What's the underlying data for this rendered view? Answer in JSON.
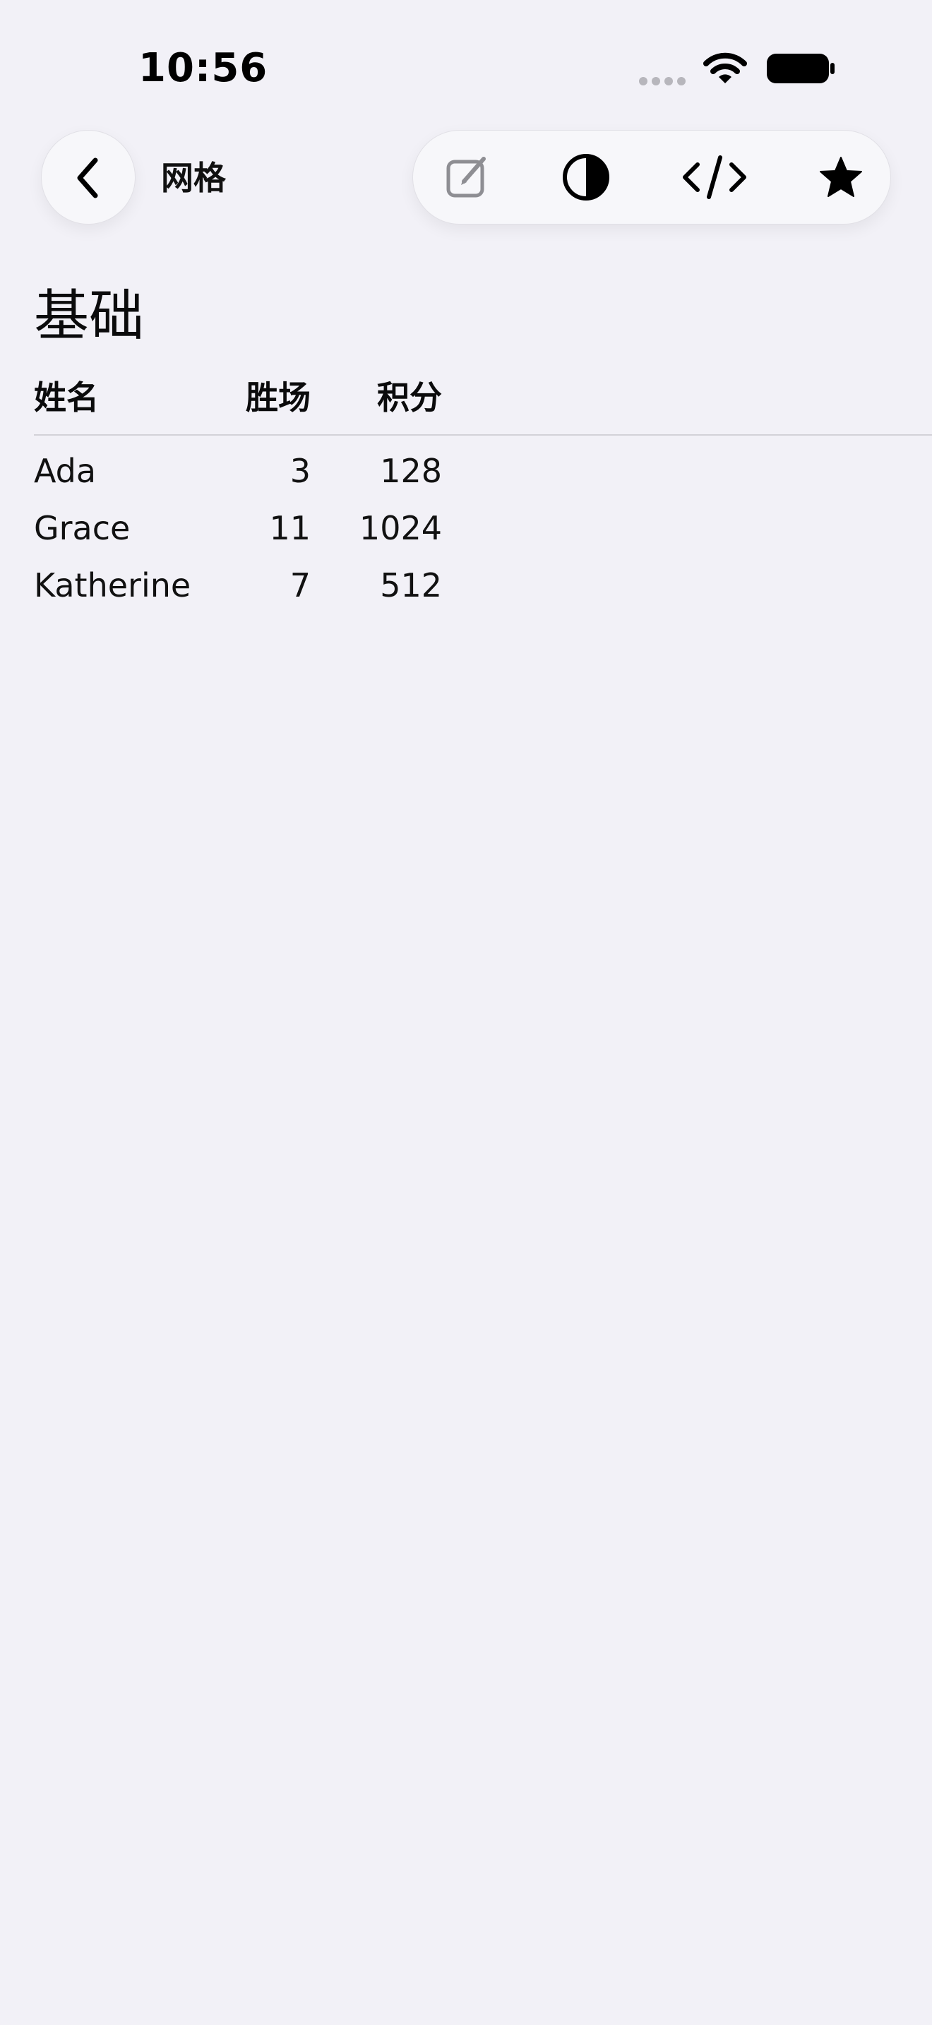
{
  "status_bar": {
    "time": "10:56"
  },
  "nav": {
    "title": "网格",
    "back_icon": "chevron-left-icon",
    "toolbar_icons": [
      "edit-icon",
      "contrast-icon",
      "code-icon",
      "star-icon"
    ]
  },
  "section": {
    "title": "基础"
  },
  "grid": {
    "headers": {
      "name": "姓名",
      "wins": "胜场",
      "points": "积分"
    },
    "rows": [
      {
        "name": "Ada",
        "wins": "3",
        "points": "128"
      },
      {
        "name": "Grace",
        "wins": "11",
        "points": "1024"
      },
      {
        "name": "Katherine",
        "wins": "7",
        "points": "512"
      }
    ]
  },
  "colors": {
    "background": "#f2f1f7",
    "text": "#0b0b0c",
    "divider": "#d3d2d8",
    "edit_icon": "#8e8e93"
  }
}
